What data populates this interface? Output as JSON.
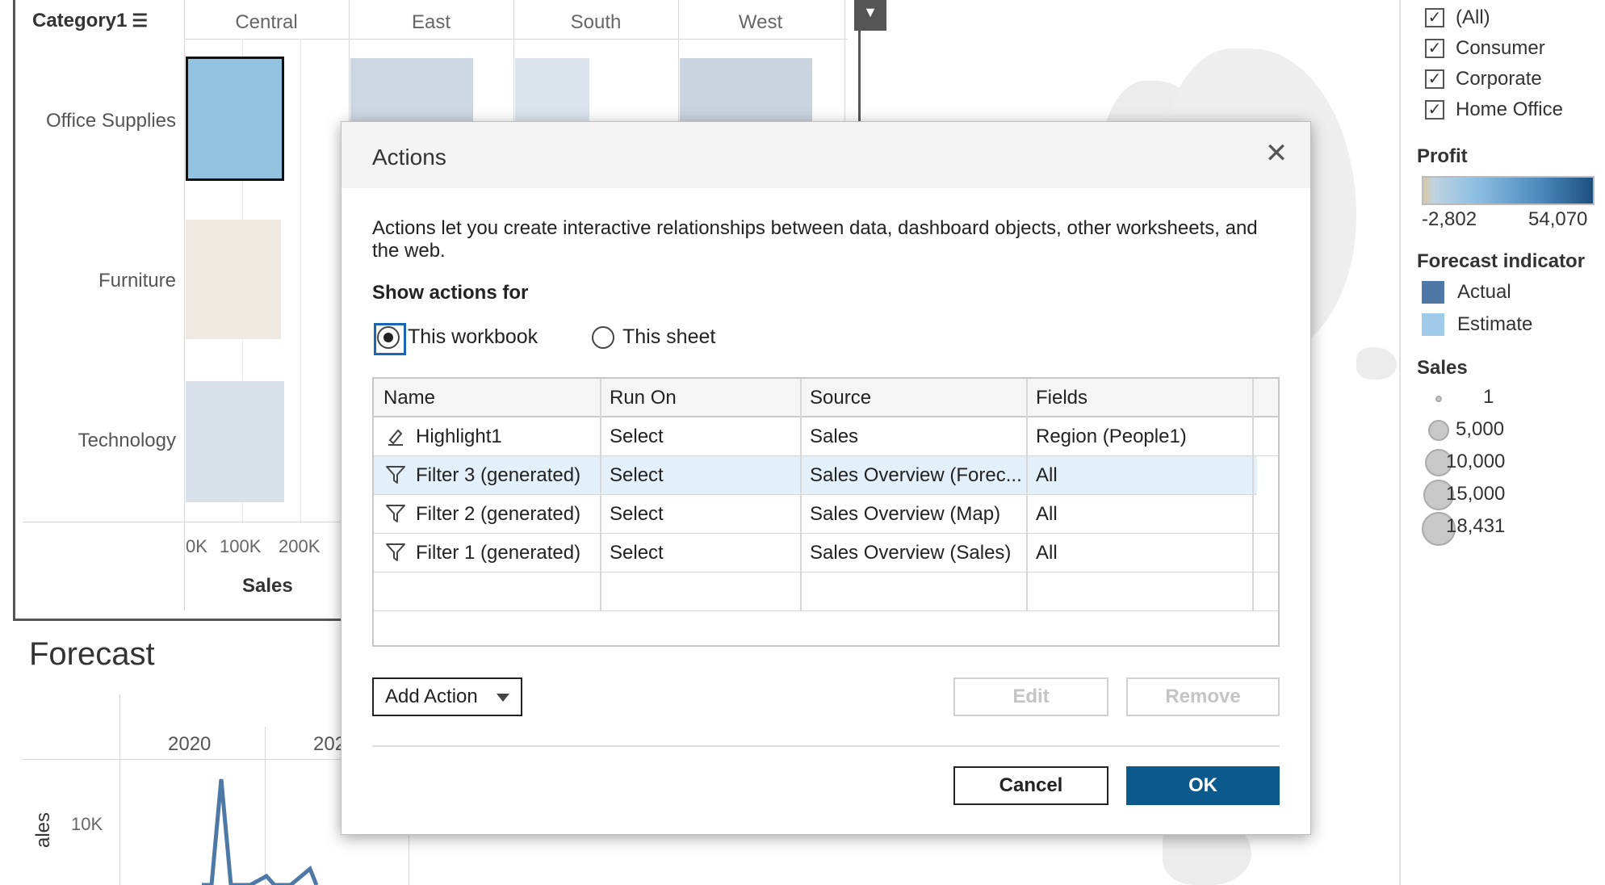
{
  "worksheet": {
    "category_header": "Category1",
    "regions": [
      "Central",
      "East",
      "South",
      "West"
    ],
    "categories": [
      "Office Supplies",
      "Furniture",
      "Technology"
    ],
    "x_ticks": [
      "0K",
      "100K",
      "200K"
    ],
    "x_title": "Sales"
  },
  "forecast": {
    "title": "Forecast",
    "years": [
      "2020",
      "202"
    ],
    "y_tick": "10K",
    "y_title": "ales"
  },
  "legend": {
    "segment_items": [
      "(All)",
      "Consumer",
      "Corporate",
      "Home Office"
    ],
    "profit_title": "Profit",
    "profit_min": "-2,802",
    "profit_max": "54,070",
    "forecast_title": "Forecast indicator",
    "forecast_items": [
      {
        "label": "Actual",
        "color": "#4e79a7"
      },
      {
        "label": "Estimate",
        "color": "#a0cbe8"
      }
    ],
    "sales_title": "Sales",
    "sales_sizes": [
      "1",
      "5,000",
      "10,000",
      "15,000",
      "18,431"
    ]
  },
  "dialog": {
    "title": "Actions",
    "close_icon": "close-icon",
    "description": "Actions let you create interactive relationships between data, dashboard objects, other worksheets, and the web.",
    "show_for_label": "Show actions for",
    "radio_options": [
      {
        "label": "This workbook",
        "selected": true
      },
      {
        "label": "This sheet",
        "selected": false
      }
    ],
    "columns": [
      "Name",
      "Run On",
      "Source",
      "Fields"
    ],
    "rows": [
      {
        "icon": "highlight-icon",
        "name": "Highlight1",
        "run_on": "Select",
        "source": "Sales",
        "fields": "Region (People1)",
        "selected": false
      },
      {
        "icon": "filter-icon",
        "name": "Filter 3 (generated)",
        "run_on": "Select",
        "source": "Sales Overview (Forec...",
        "fields": "All",
        "selected": true
      },
      {
        "icon": "filter-icon",
        "name": "Filter 2 (generated)",
        "run_on": "Select",
        "source": "Sales Overview (Map)",
        "fields": "All",
        "selected": false
      },
      {
        "icon": "filter-icon",
        "name": "Filter 1 (generated)",
        "run_on": "Select",
        "source": "Sales Overview (Sales)",
        "fields": "All",
        "selected": false
      }
    ],
    "add_action_label": "Add Action",
    "edit_label": "Edit",
    "remove_label": "Remove",
    "cancel_label": "Cancel",
    "ok_label": "OK"
  }
}
